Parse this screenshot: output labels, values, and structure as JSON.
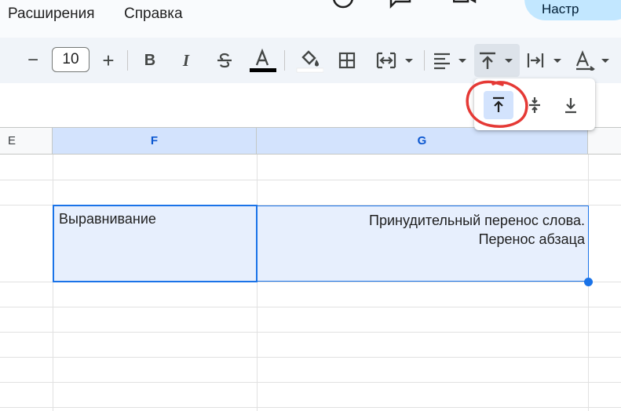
{
  "menu": {
    "items": [
      "Расширения",
      "Справка"
    ]
  },
  "header": {
    "share_label": "Настр"
  },
  "toolbar": {
    "minus_label": "−",
    "font_size": "10",
    "plus_label": "+",
    "bold_label": "B",
    "italic_label": "I",
    "text_color": "#000000",
    "fill_color": "#ffffff"
  },
  "valign_menu": {
    "options": [
      "top-align",
      "middle-align",
      "bottom-align"
    ],
    "selected": "top-align",
    "annotation_color": "#e53935"
  },
  "sheet": {
    "columns": [
      "E",
      "F",
      "G"
    ],
    "selected_columns": [
      "F",
      "G"
    ],
    "cells": {
      "f": "Выравнивание",
      "g_line1": "Принудительный перенос слова.",
      "g_line2": "Перенос абзаца"
    }
  },
  "colors": {
    "selection": "#1a73e8",
    "selection_fill": "#e7effd",
    "header_selected": "#d3e3fd",
    "toolbar_bg": "#f0f4f9"
  }
}
